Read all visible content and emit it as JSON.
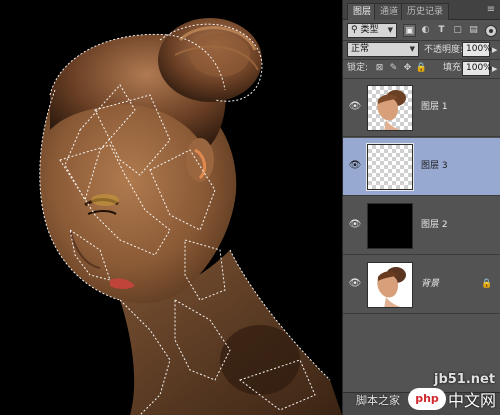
{
  "panel": {
    "tabs": [
      "图层",
      "通道",
      "历史记录"
    ],
    "menu_icon": "panel-menu-icon",
    "filter": {
      "kind_label": "类型",
      "icons": [
        "image-filter-icon",
        "adjustment-filter-icon",
        "text-filter-icon",
        "shape-filter-icon",
        "smartobject-filter-icon"
      ]
    },
    "blend": {
      "mode": "正常",
      "opacity_label": "不透明度:",
      "opacity_value": "100%"
    },
    "lock": {
      "label": "锁定:",
      "fill_label": "填充:",
      "fill_value": "100%"
    },
    "layers": [
      {
        "name": "图层 1",
        "thumb": "portrait-transparent",
        "visible": true,
        "selected": false
      },
      {
        "name": "图层 3",
        "thumb": "transparent",
        "visible": true,
        "selected": true
      },
      {
        "name": "图层 2",
        "thumb": "black",
        "visible": true,
        "selected": false
      },
      {
        "name": "背景",
        "thumb": "portrait-white",
        "visible": true,
        "selected": false,
        "locked": true
      }
    ]
  },
  "watermark": {
    "url": "jb51.net",
    "badge": "php",
    "text": "中文网",
    "cn": "脚本之家"
  },
  "colors": {
    "panel_bg": "#535353",
    "selected_layer": "#98a9d1",
    "canvas_bg": "#000000"
  }
}
